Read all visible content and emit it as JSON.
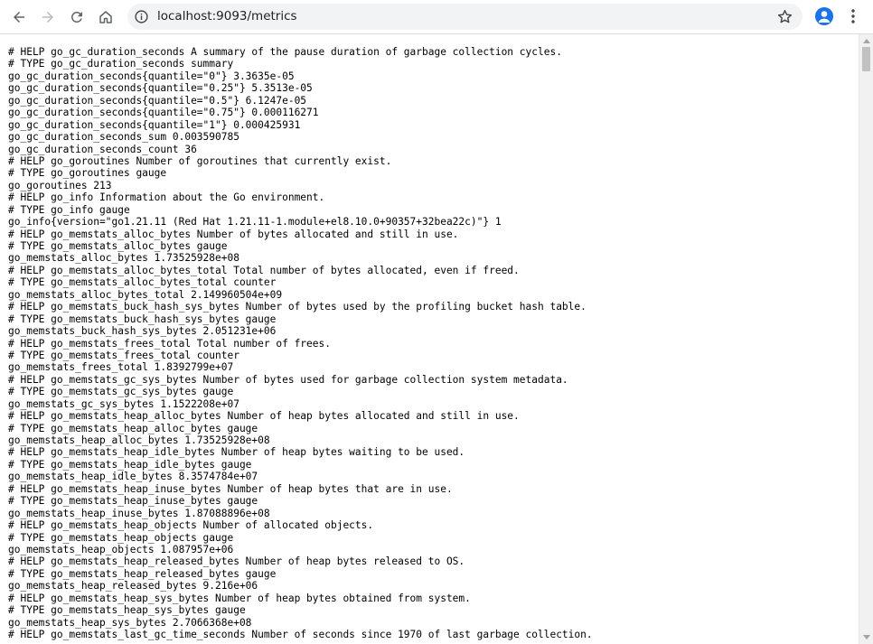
{
  "browser": {
    "url": "localhost:9093/metrics",
    "icons": {
      "back": "arrow-left-icon",
      "forward": "arrow-right-icon",
      "reload": "reload-icon",
      "home": "home-icon",
      "site_info": "info-icon",
      "bookmark": "star-icon",
      "profile": "person-icon",
      "menu": "kebab-menu-icon"
    },
    "accent_color": "#1a73e8"
  },
  "metrics_lines": [
    "# HELP go_gc_duration_seconds A summary of the pause duration of garbage collection cycles.",
    "# TYPE go_gc_duration_seconds summary",
    "go_gc_duration_seconds{quantile=\"0\"} 3.3635e-05",
    "go_gc_duration_seconds{quantile=\"0.25\"} 5.3513e-05",
    "go_gc_duration_seconds{quantile=\"0.5\"} 6.1247e-05",
    "go_gc_duration_seconds{quantile=\"0.75\"} 0.000116271",
    "go_gc_duration_seconds{quantile=\"1\"} 0.000425931",
    "go_gc_duration_seconds_sum 0.003590785",
    "go_gc_duration_seconds_count 36",
    "# HELP go_goroutines Number of goroutines that currently exist.",
    "# TYPE go_goroutines gauge",
    "go_goroutines 213",
    "# HELP go_info Information about the Go environment.",
    "# TYPE go_info gauge",
    "go_info{version=\"go1.21.11 (Red Hat 1.21.11-1.module+el8.10.0+90357+32bea22c)\"} 1",
    "# HELP go_memstats_alloc_bytes Number of bytes allocated and still in use.",
    "# TYPE go_memstats_alloc_bytes gauge",
    "go_memstats_alloc_bytes 1.73525928e+08",
    "# HELP go_memstats_alloc_bytes_total Total number of bytes allocated, even if freed.",
    "# TYPE go_memstats_alloc_bytes_total counter",
    "go_memstats_alloc_bytes_total 2.149960504e+09",
    "# HELP go_memstats_buck_hash_sys_bytes Number of bytes used by the profiling bucket hash table.",
    "# TYPE go_memstats_buck_hash_sys_bytes gauge",
    "go_memstats_buck_hash_sys_bytes 2.051231e+06",
    "# HELP go_memstats_frees_total Total number of frees.",
    "# TYPE go_memstats_frees_total counter",
    "go_memstats_frees_total 1.8392799e+07",
    "# HELP go_memstats_gc_sys_bytes Number of bytes used for garbage collection system metadata.",
    "# TYPE go_memstats_gc_sys_bytes gauge",
    "go_memstats_gc_sys_bytes 1.1522208e+07",
    "# HELP go_memstats_heap_alloc_bytes Number of heap bytes allocated and still in use.",
    "# TYPE go_memstats_heap_alloc_bytes gauge",
    "go_memstats_heap_alloc_bytes 1.73525928e+08",
    "# HELP go_memstats_heap_idle_bytes Number of heap bytes waiting to be used.",
    "# TYPE go_memstats_heap_idle_bytes gauge",
    "go_memstats_heap_idle_bytes 8.3574784e+07",
    "# HELP go_memstats_heap_inuse_bytes Number of heap bytes that are in use.",
    "# TYPE go_memstats_heap_inuse_bytes gauge",
    "go_memstats_heap_inuse_bytes 1.87088896e+08",
    "# HELP go_memstats_heap_objects Number of allocated objects.",
    "# TYPE go_memstats_heap_objects gauge",
    "go_memstats_heap_objects 1.087957e+06",
    "# HELP go_memstats_heap_released_bytes Number of heap bytes released to OS.",
    "# TYPE go_memstats_heap_released_bytes gauge",
    "go_memstats_heap_released_bytes 9.216e+06",
    "# HELP go_memstats_heap_sys_bytes Number of heap bytes obtained from system.",
    "# TYPE go_memstats_heap_sys_bytes gauge",
    "go_memstats_heap_sys_bytes 2.7066368e+08",
    "# HELP go_memstats_last_gc_time_seconds Number of seconds since 1970 of last garbage collection."
  ]
}
